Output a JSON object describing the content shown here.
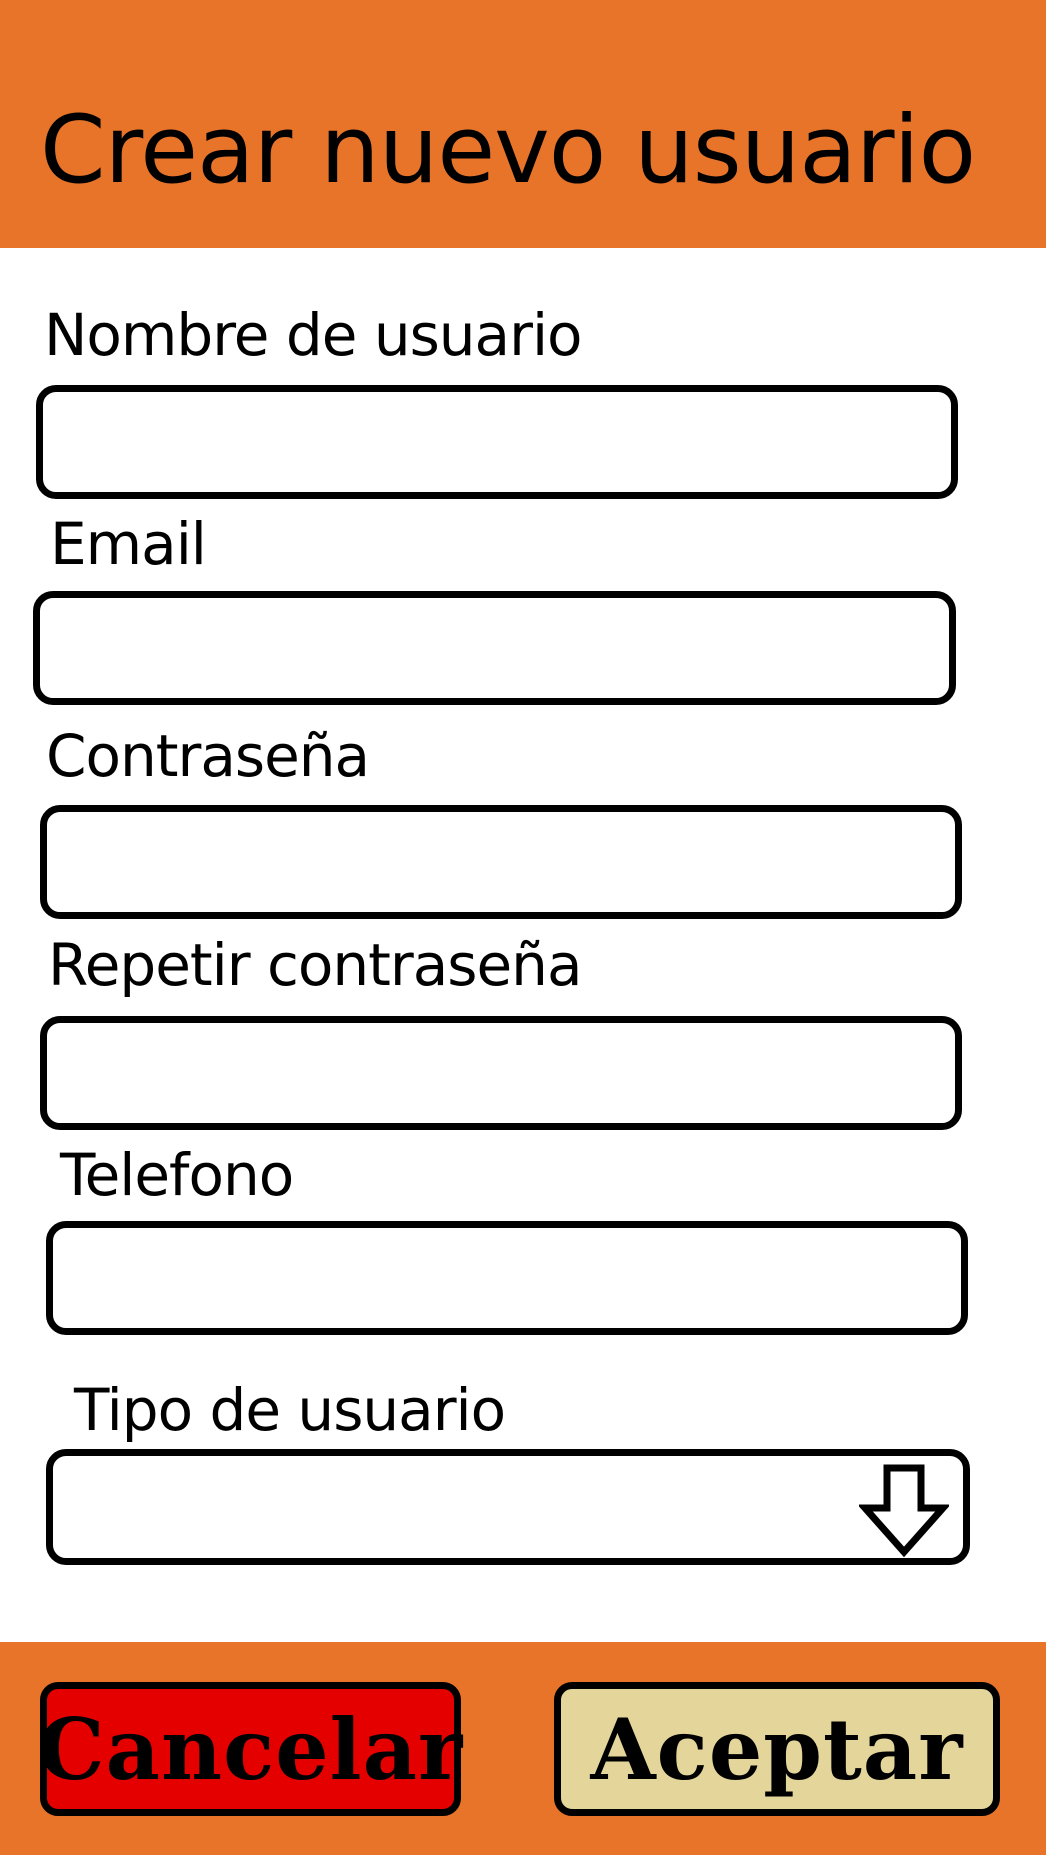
{
  "header": {
    "title": "Crear nuevo usuario"
  },
  "form": {
    "fields": [
      {
        "label": "Nombre de usuario",
        "value": "",
        "placeholder": ""
      },
      {
        "label": "Email",
        "value": "",
        "placeholder": ""
      },
      {
        "label": "Contraseña",
        "value": "",
        "placeholder": ""
      },
      {
        "label": "Repetir contraseña",
        "value": "",
        "placeholder": ""
      },
      {
        "label": "Telefono",
        "value": "",
        "placeholder": ""
      }
    ],
    "user_type": {
      "label": "Tipo de usuario",
      "selected": "",
      "icon": "arrow-down-icon"
    }
  },
  "footer": {
    "cancel_label": "Cancelar",
    "accept_label": "Aceptar"
  },
  "colors": {
    "header_bg": "#e8742a",
    "cancel_bg": "#e50000",
    "accept_bg": "#e4d59a"
  }
}
